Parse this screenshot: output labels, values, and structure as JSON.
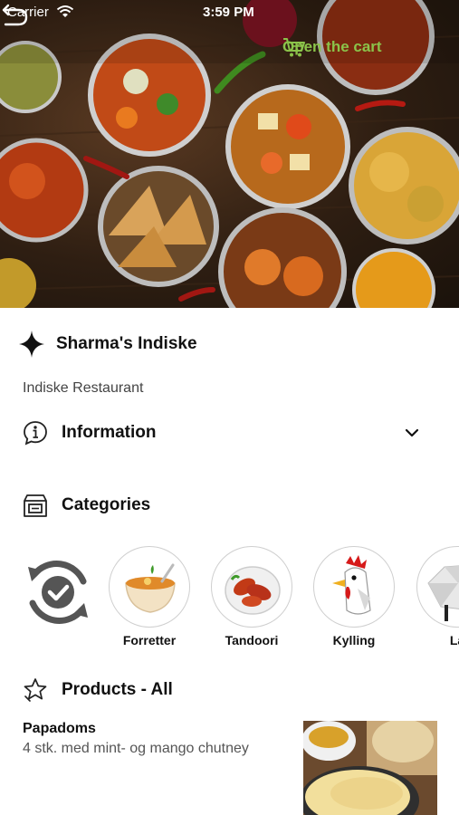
{
  "status_bar": {
    "carrier": "Carrier",
    "time": "3:59 PM"
  },
  "header": {
    "cart_label": "Open the cart",
    "accent_color": "#8bc34a"
  },
  "shop": {
    "name": "Sharma's Indiske",
    "type": "Indiske Restaurant"
  },
  "information": {
    "title": "Information"
  },
  "categories": {
    "title": "Categories",
    "items": [
      {
        "label": "Forretter",
        "icon": "soup-bowl-icon"
      },
      {
        "label": "Tandoori",
        "icon": "tandoori-chicken-icon"
      },
      {
        "label": "Kylling",
        "icon": "rooster-icon"
      },
      {
        "label": "La",
        "icon": "sheep-icon"
      }
    ]
  },
  "products": {
    "title": "Products - All",
    "items": [
      {
        "name": "Papadoms",
        "description": "4 stk. med mint- og mango chutney"
      }
    ]
  }
}
